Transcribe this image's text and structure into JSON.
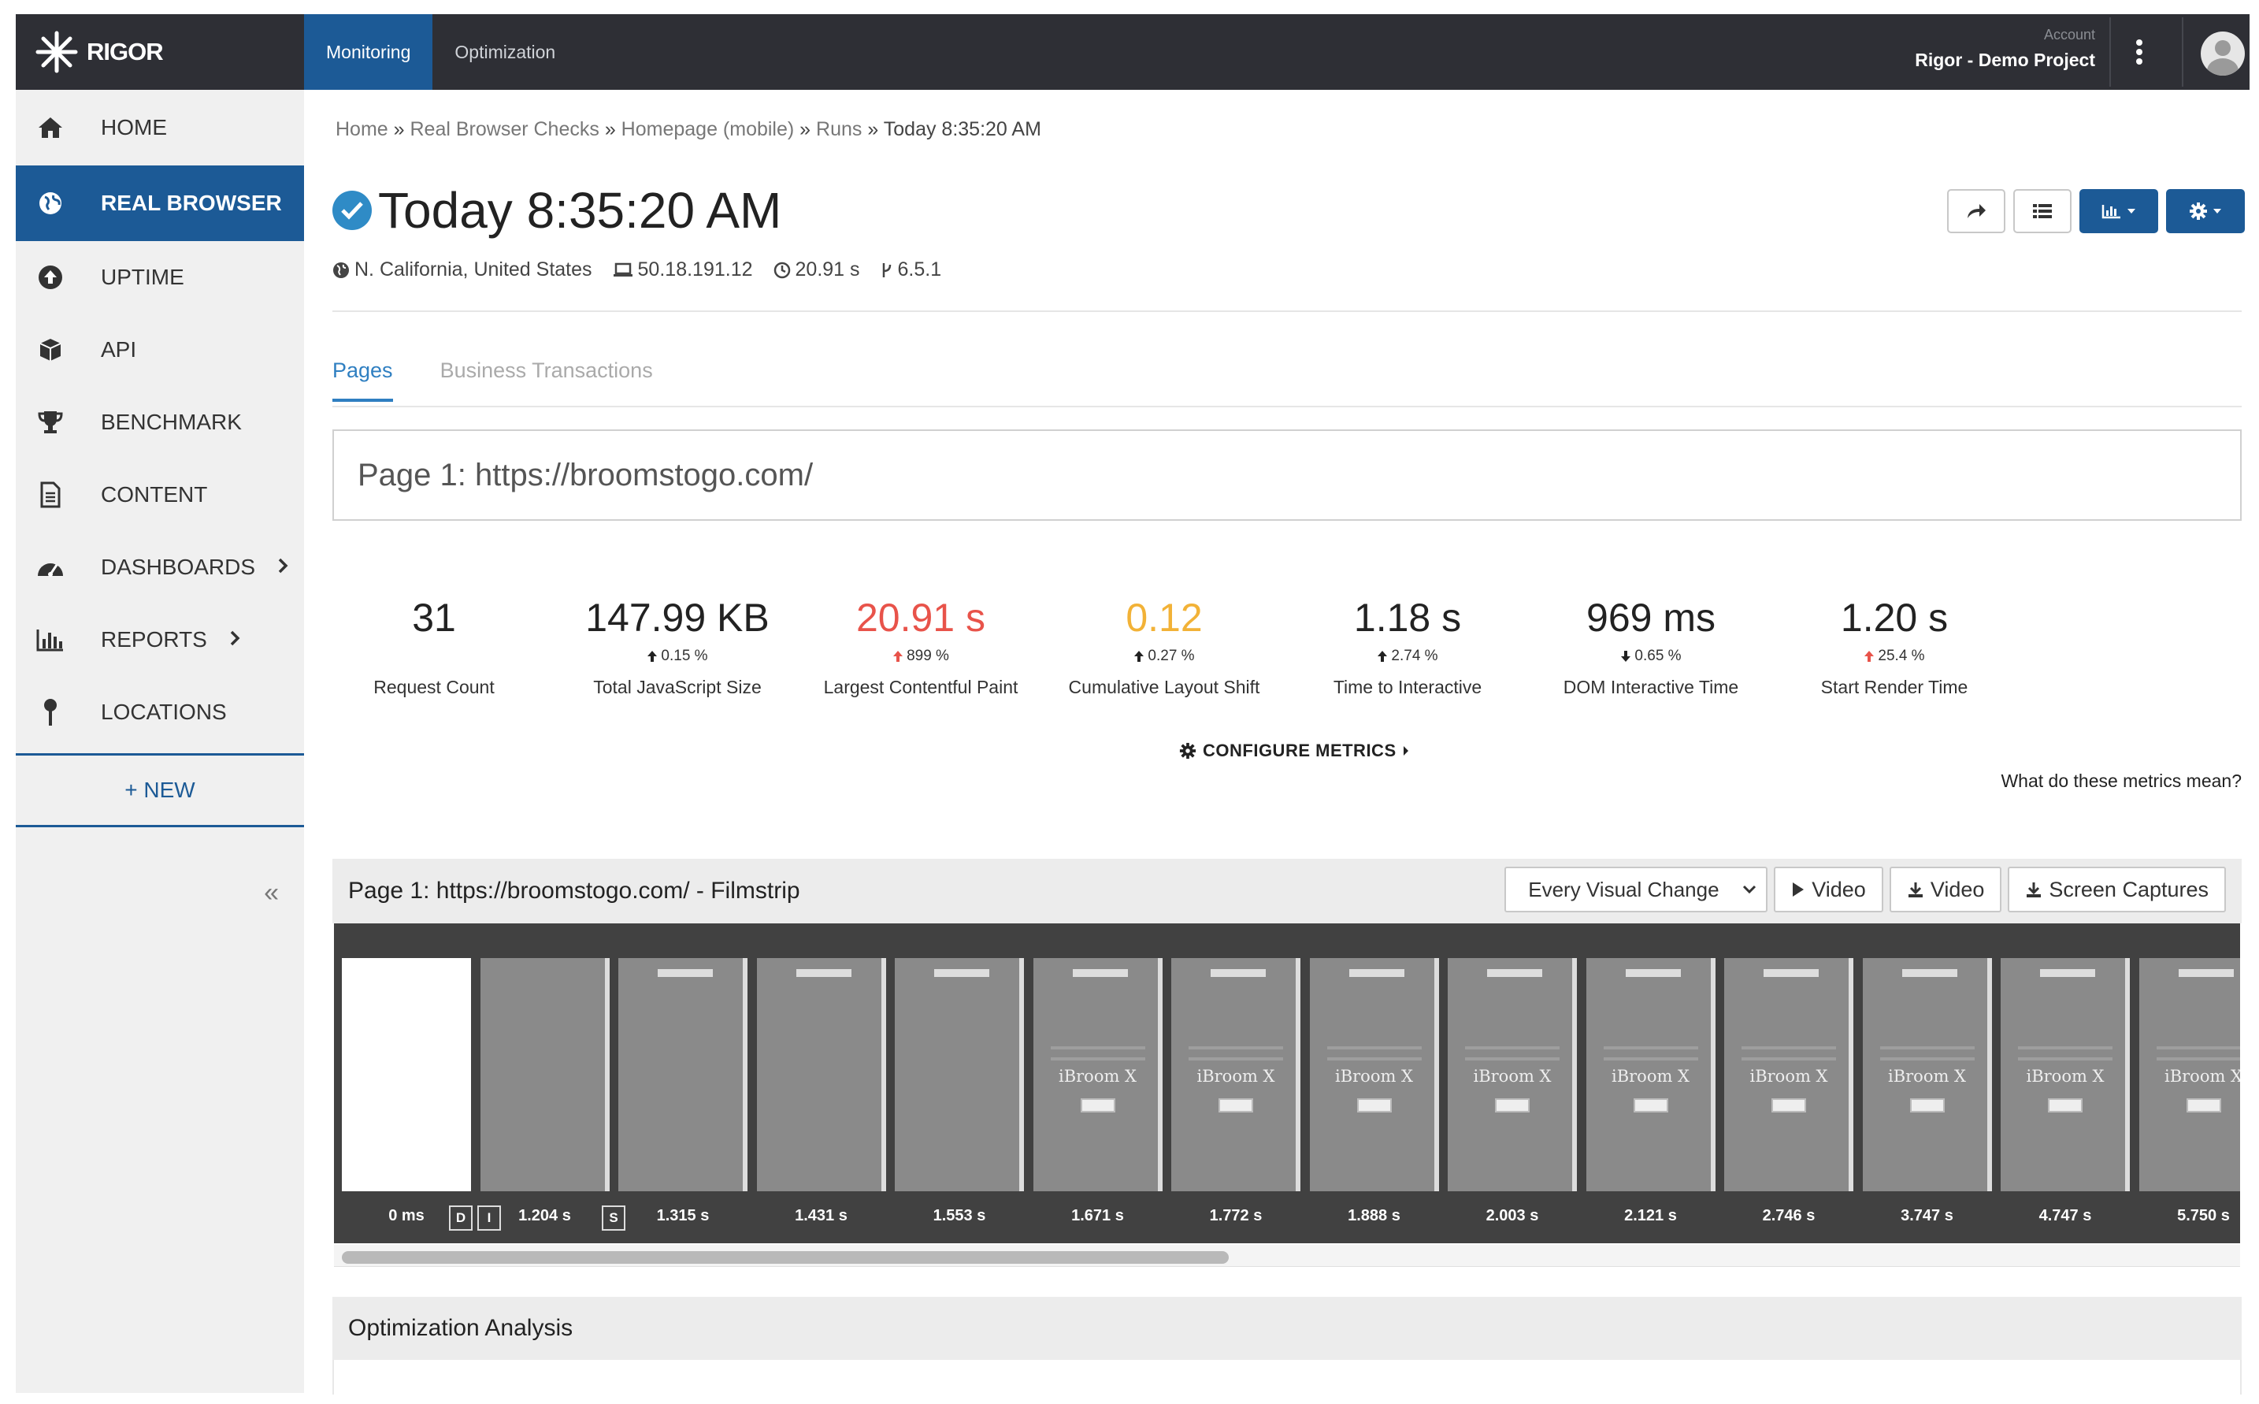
{
  "brand": {
    "name": "RIGOR"
  },
  "topnav": {
    "tabs": [
      "Monitoring",
      "Optimization"
    ],
    "active": "Monitoring"
  },
  "account": {
    "label": "Account",
    "name": "Rigor - Demo Project"
  },
  "sidebar": {
    "items": [
      {
        "label": "HOME",
        "icon": "home-icon"
      },
      {
        "label": "REAL BROWSER",
        "icon": "globe-icon",
        "active": true
      },
      {
        "label": "UPTIME",
        "icon": "upload-circle-icon"
      },
      {
        "label": "API",
        "icon": "cubes-icon"
      },
      {
        "label": "BENCHMARK",
        "icon": "trophy-icon"
      },
      {
        "label": "CONTENT",
        "icon": "file-icon"
      },
      {
        "label": "DASHBOARDS",
        "icon": "dashboard-icon",
        "chevron": true
      },
      {
        "label": "REPORTS",
        "icon": "bar-chart-icon",
        "chevron": true
      },
      {
        "label": "LOCATIONS",
        "icon": "map-pin-icon"
      }
    ],
    "new_label": "+ NEW",
    "collapse_label": "«"
  },
  "breadcrumb": {
    "items": [
      "Home",
      "Real Browser Checks",
      "Homepage (mobile)",
      "Runs",
      "Today 8:35:20 AM"
    ],
    "separator": "»"
  },
  "run": {
    "title": "Today 8:35:20 AM",
    "status": "success",
    "location": "N. California, United States",
    "ip": "50.18.191.12",
    "duration": "20.91 s",
    "version": "6.5.1"
  },
  "tabs": {
    "items": [
      "Pages",
      "Business Transactions"
    ],
    "active": "Pages"
  },
  "page_url_heading": "Page 1: https://broomstogo.com/",
  "metrics": [
    {
      "value": "31",
      "label": "Request Count",
      "delta": "",
      "dir": "",
      "color": "#222222"
    },
    {
      "value": "147.99 KB",
      "label": "Total JavaScript Size",
      "delta": "0.15 %",
      "dir": "up",
      "arrow_color": "#222222",
      "color": "#222222"
    },
    {
      "value": "20.91 s",
      "label": "Largest Contentful Paint",
      "delta": "899 %",
      "dir": "up",
      "arrow_color": "#e8534a",
      "color": "#e8534a"
    },
    {
      "value": "0.12",
      "label": "Cumulative Layout Shift",
      "delta": "0.27 %",
      "dir": "up",
      "arrow_color": "#222222",
      "color": "#f2b237"
    },
    {
      "value": "1.18 s",
      "label": "Time to Interactive",
      "delta": "2.74 %",
      "dir": "up",
      "arrow_color": "#222222",
      "color": "#222222"
    },
    {
      "value": "969 ms",
      "label": "DOM Interactive Time",
      "delta": "0.65 %",
      "dir": "down",
      "arrow_color": "#222222",
      "color": "#222222"
    },
    {
      "value": "1.20 s",
      "label": "Start Render Time",
      "delta": "25.4 %",
      "dir": "up",
      "arrow_color": "#e8534a",
      "color": "#222222"
    }
  ],
  "configure_metrics": "CONFIGURE METRICS",
  "what_metrics": "What do these metrics mean?",
  "filmstrip": {
    "title": "Page 1: https://broomstogo.com/ - Filmstrip",
    "select_value": "Every Visual Change",
    "buttons": [
      "Video",
      "Video",
      "Screen Captures"
    ],
    "frame_brand": "iBroom X",
    "markers": [
      "D",
      "I",
      "S"
    ],
    "times": [
      "0 ms",
      "1.204 s",
      "1.315 s",
      "1.431 s",
      "1.553 s",
      "1.671 s",
      "1.772 s",
      "1.888 s",
      "2.003 s",
      "2.121 s",
      "2.746 s",
      "3.747 s",
      "4.747 s",
      "5.750 s"
    ]
  },
  "optimization": {
    "title": "Optimization Analysis"
  },
  "colors": {
    "accent": "#1c5a96",
    "topbar": "#2e2f35",
    "tab_active": "#2f7fc1",
    "error": "#e8534a",
    "warning": "#f2b237"
  }
}
